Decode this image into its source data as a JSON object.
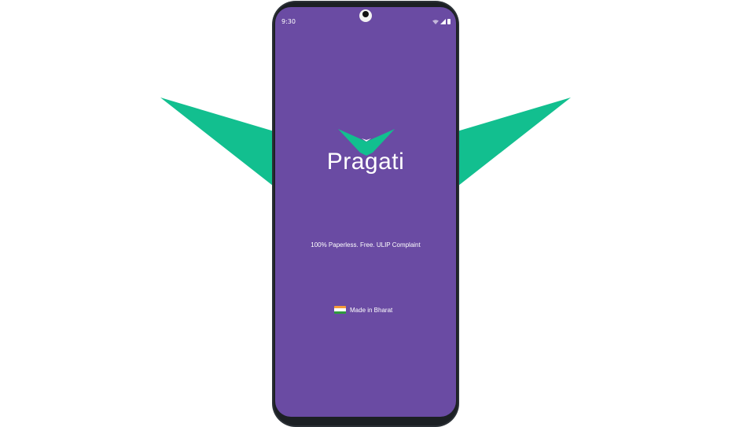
{
  "status_bar": {
    "time": "9:30",
    "icons": [
      "wifi-icon",
      "signal-icon",
      "battery-icon"
    ]
  },
  "app": {
    "name": "Pragati",
    "logo_icon": "chevron-v-logo",
    "tagline": "100% Paperless. Free. ULIP Complaint",
    "footer": {
      "flag_icon": "india-flag-icon",
      "label": "Made in Bharat"
    }
  },
  "colors": {
    "screen_background": "#6a4ba3",
    "accent_green": "#12bf8f",
    "text": "#ffffff",
    "phone_body": "#2b3036"
  }
}
